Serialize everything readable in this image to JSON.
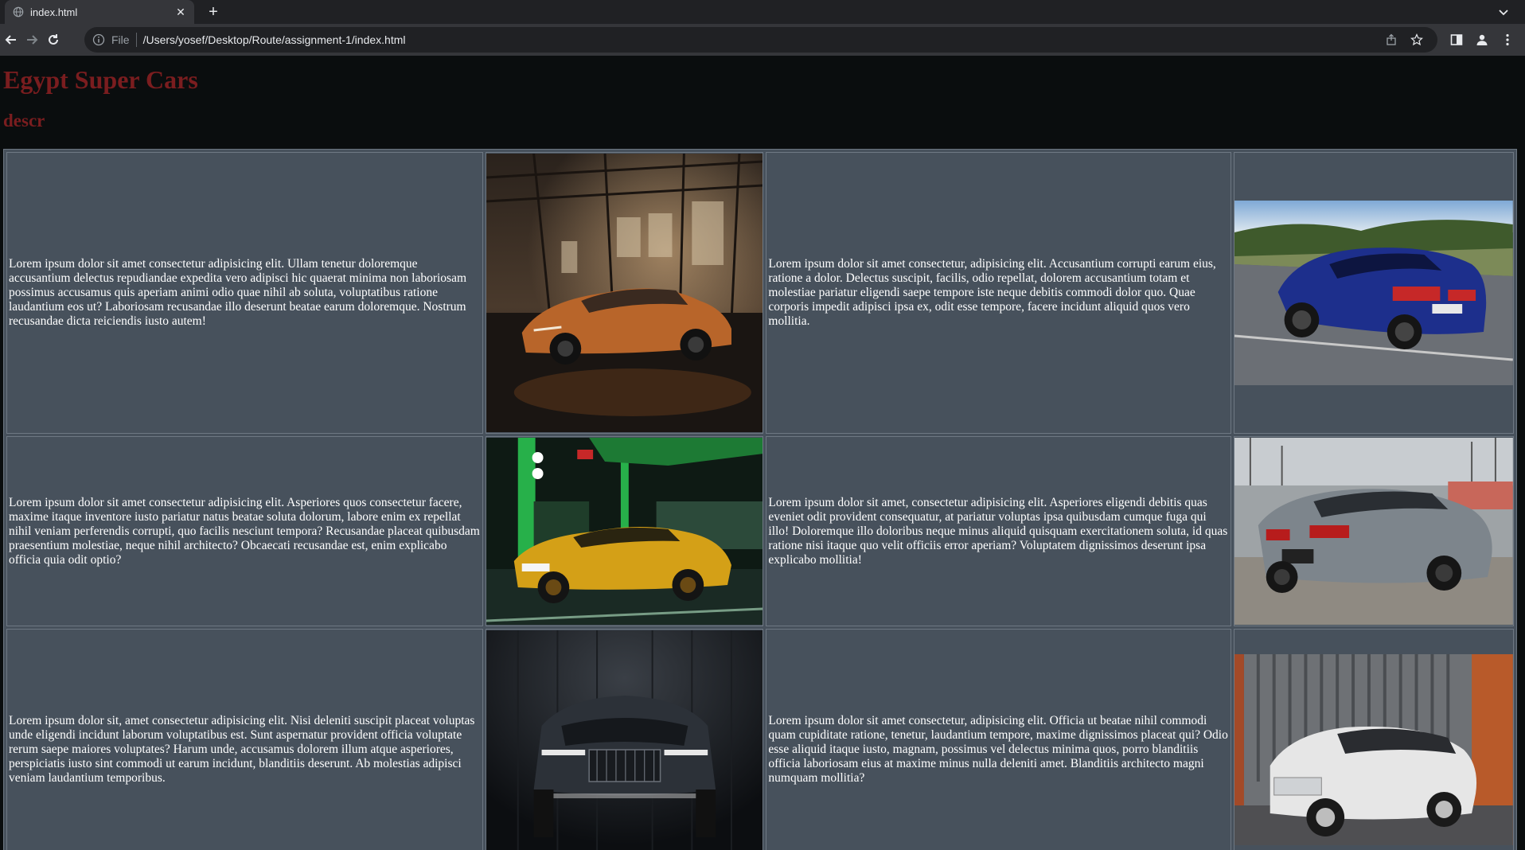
{
  "browser": {
    "tab_title": "index.html",
    "url_scheme": "File",
    "url": "/Users/yosef/Desktop/Route/assignment-1/index.html"
  },
  "page": {
    "title": "Egypt Super Cars",
    "description": "descr"
  },
  "rows": [
    {
      "text_left": "Lorem ipsum dolor sit amet consectetur adipisicing elit. Ullam tenetur doloremque accusantium delectus repudiandae expedita vero adipisci hic quaerat minima non laboriosam possimus accusamus quis aperiam animi odio quae nihil ab soluta, voluptatibus ratione laudantium eos ut? Laboriosam recusandae illo deserunt beatae earum doloremque. Nostrum recusandae dicta reiciendis iusto autem!",
      "text_right": "Lorem ipsum dolor sit amet consectetur, adipisicing elit. Accusantium corrupti earum eius, ratione a dolor. Delectus suscipit, facilis, odio repellat, dolorem accusantium totam et molestiae pariatur eligendi saepe tempore iste neque debitis commodi dolor quo. Quae corporis impedit adipisci ipsa ex, odit esse tempore, facere incidunt aliquid quos vero mollitia.",
      "photo_left": "orange-porsche-in-warehouse",
      "photo_right": "blue-bmw-on-road"
    },
    {
      "text_left": "Lorem ipsum dolor sit amet consectetur adipisicing elit. Asperiores quos consectetur facere, maxime itaque inventore iusto pariatur natus beatae soluta dolorum, labore enim ex repellat nihil veniam perferendis corrupti, quo facilis nesciunt tempora? Recusandae placeat quibusdam praesentium molestiae, neque nihil architecto? Obcaecati recusandae est, enim explicabo officia quia odit optio?",
      "text_right": "Lorem ipsum dolor sit amet, consectetur adipisicing elit. Asperiores eligendi debitis quas eveniet odit provident consequatur, at pariatur voluptas ipsa quibusdam cumque fuga qui illo! Doloremque illo doloribus neque minus aliquid quisquam exercitationem soluta, id quas ratione nisi itaque quo velit officiis error aperiam? Voluptatem dignissimos deserunt ipsa explicabo mollitia!",
      "photo_left": "yellow-bmw-at-gas-station",
      "photo_right": "grey-bmw-at-harbor"
    },
    {
      "text_left": "Lorem ipsum dolor sit, amet consectetur adipisicing elit. Nisi deleniti suscipit placeat voluptas unde eligendi incidunt laborum voluptatibus est. Sunt aspernatur provident officia voluptate rerum saepe maiores voluptates? Harum unde, accusamus dolorem illum atque asperiores, perspiciatis iusto sint commodi ut earum incidunt, blanditiis deserunt. Ab molestias adipisci veniam laudantium temporibus.",
      "text_right": "Lorem ipsum dolor sit amet consectetur, adipisicing elit. Officia ut beatae nihil commodi quam cupiditate ratione, tenetur, laudantium tempore, maxime dignissimos placeat qui? Odio esse aliquid itaque iusto, magnam, possimus vel delectus minima quos, porro blanditiis officia laboriosam eius at maxime minus nulla deleniti amet. Blanditiis architecto magni numquam mollitia?",
      "photo_left": "dark-suv-front-view",
      "photo_right": "white-volvo-suv"
    }
  ],
  "colors": {
    "heading": "#7a1d1f",
    "cell_bg": "#47515c",
    "page_bg": "#0a0d0e"
  }
}
